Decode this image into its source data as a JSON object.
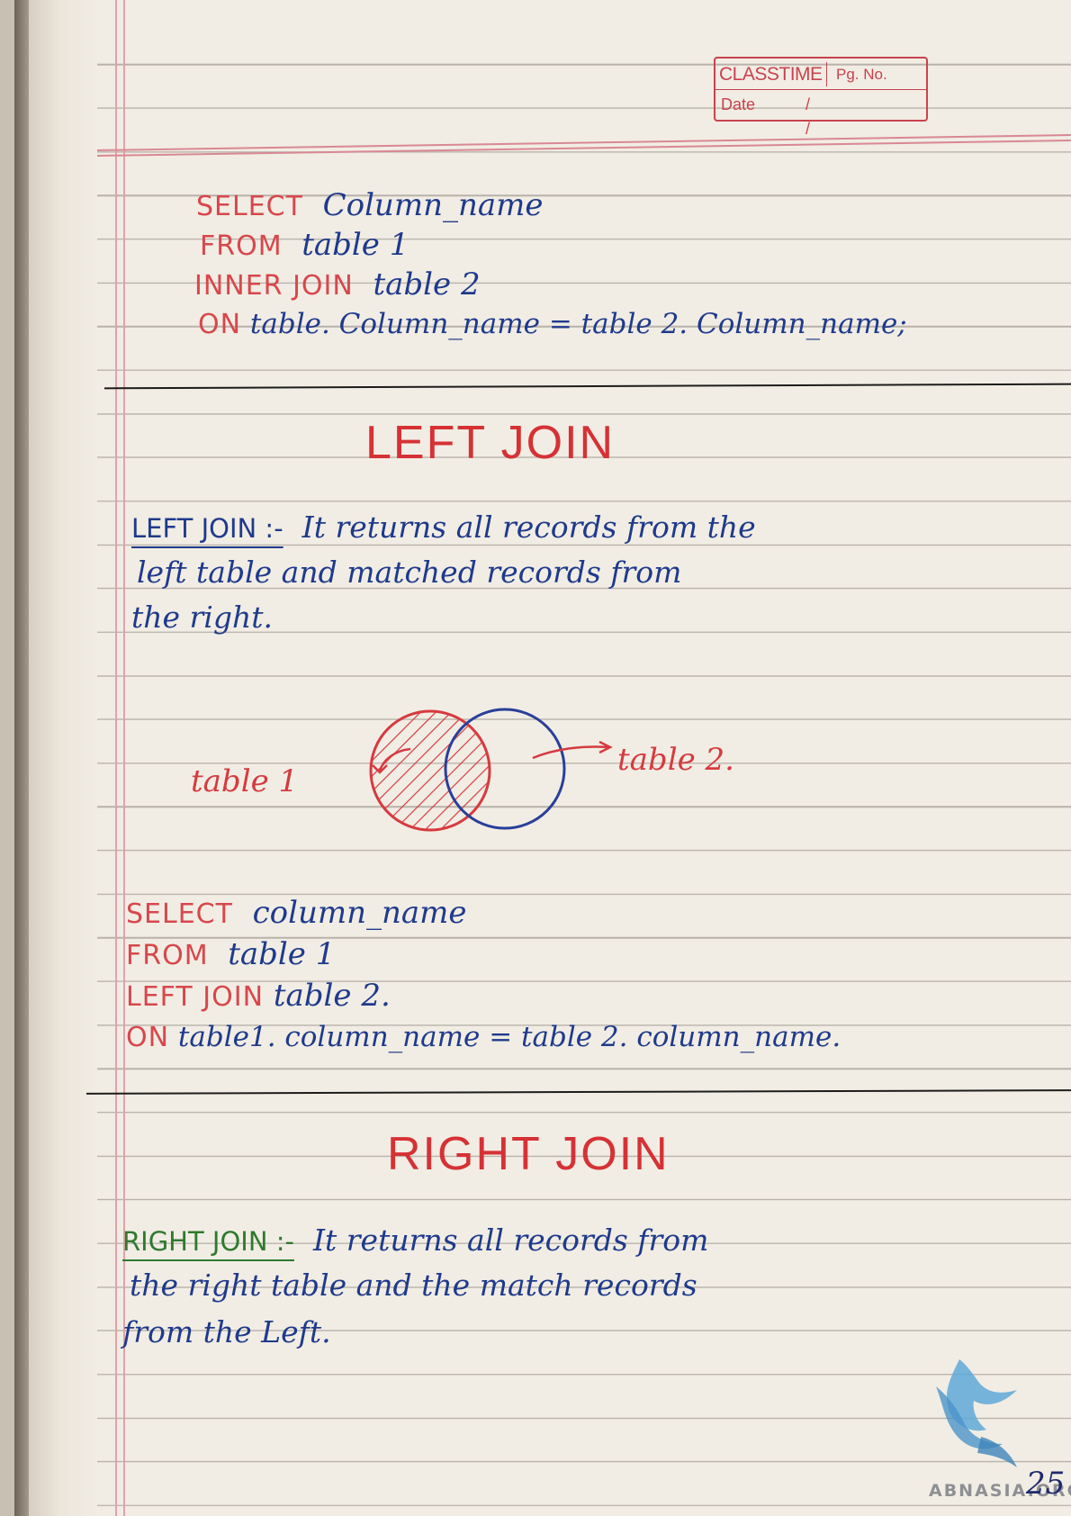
{
  "header": {
    "brand": "CLASSTIME",
    "page_label": "Pg. No.",
    "date_label": "Date",
    "date_slashes": "/  /"
  },
  "inner_join_query": {
    "line1_kw": "SELECT",
    "line1_rest": "Column_name",
    "line2_kw": "FROM",
    "line2_rest": "table 1",
    "line3_kw": "INNER JOIN",
    "line3_rest": "table 2",
    "line4_kw": "ON",
    "line4_rest": "table. Column_name = table 2. Column_name;"
  },
  "left_join": {
    "title": "LEFT JOIN",
    "term": "LEFT JOIN :-",
    "def_line1": "It returns all records from the",
    "def_line2": "left table and matched records from",
    "def_line3": "the right.",
    "diagram": {
      "label_left": "table 1",
      "label_right": "table 2."
    },
    "query": {
      "line1_kw": "SELECT",
      "line1_rest": "column_name",
      "line2_kw": "FROM",
      "line2_rest": "table 1",
      "line3_kw": "LEFT JOIN",
      "line3_rest": "table 2.",
      "line4_kw": "ON",
      "line4_rest": "table1. column_name = table 2. column_name."
    }
  },
  "right_join": {
    "title": "RIGHT JOIN",
    "term": "RIGHT JOIN :-",
    "def_line1": "It returns all records from",
    "def_line2": "the right table and the match records",
    "def_line3": "from the Left."
  },
  "watermark": "ABNASIA.ORG",
  "page_number": "25",
  "colors": {
    "keyword_red": "#d63a3f",
    "ink_blue": "#1f3a8c",
    "term_green": "#2f7a2e"
  }
}
